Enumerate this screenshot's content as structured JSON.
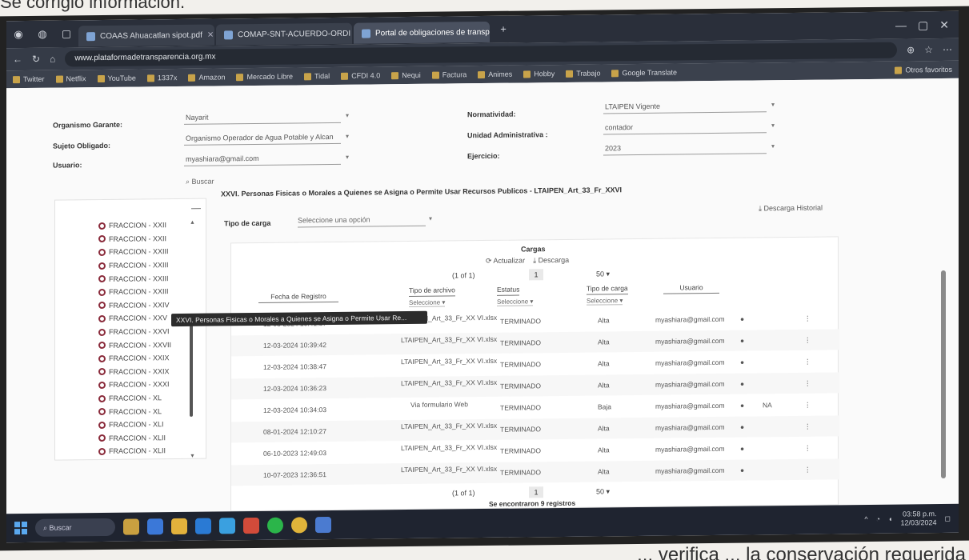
{
  "captions": {
    "top": "Se corrigió información.",
    "bottom": "... verifica ... la conservación requerida"
  },
  "browser": {
    "tabs": [
      {
        "label": "COAAS Ahuacatlan sipot.pdf"
      },
      {
        "label": "COMAP-SNT-ACUERDO-ORDI"
      },
      {
        "label": "Portal de obligaciones de transparencia"
      }
    ],
    "url": "www.plataformadetransparencia.org.mx",
    "bookmarks": [
      "Twitter",
      "Netflix",
      "YouTube",
      "1337x",
      "Amazon",
      "Mercado Libre",
      "Tidal",
      "CFDI 4.0",
      "Nequi",
      "Factura",
      "Animes",
      "Hobby",
      "Trabajo",
      "Google Translate"
    ],
    "bookmarks_right": "Otros favoritos"
  },
  "form": {
    "organismo_label": "Organismo Garante:",
    "organismo_value": "Nayarit",
    "sujeto_label": "Sujeto Obligado:",
    "sujeto_value": "Organismo Operador de Agua Potable y Alcan",
    "usuario_label": "Usuario:",
    "usuario_value": "myashiara@gmail.com",
    "normatividad_label": "Normatividad:",
    "normatividad_value": "LTAIPEN Vigente",
    "unidad_label": "Unidad Administrativa :",
    "unidad_value": "contador",
    "ejercicio_label": "Ejercicio:",
    "ejercicio_value": "2023",
    "buscar": "Buscar"
  },
  "fraccion_title": "XXVI. Personas Fisicas o Morales a Quienes se Asigna o Permite Usar Recursos Publicos - LTAIPEN_Art_33_Fr_XXVI",
  "descarga_historial": "Descarga Historial",
  "fracciones": [
    "FRACCION - XXII",
    "FRACCION - XXII",
    "FRACCION - XXIII",
    "FRACCION - XXIII",
    "FRACCION - XXIII",
    "FRACCION - XXIII",
    "FRACCION - XXIV",
    "FRACCION - XXV",
    "FRACCION - XXVI",
    "FRACCION - XXVII",
    "FRACCION - XXIX",
    "FRACCION - XXIX",
    "FRACCION - XXXI",
    "FRACCION - XL",
    "FRACCION - XL",
    "FRACCION - XLI",
    "FRACCION - XLII",
    "FRACCION - XLII"
  ],
  "tooltip": "XXVI. Personas Fisicas o Morales a Quienes se Asigna o Permite Usar Re...",
  "tipo_carga": {
    "label": "Tipo de carga",
    "placeholder": "Seleccione una opción"
  },
  "cargas": {
    "title": "Cargas",
    "actualizar": "Actualizar",
    "descarga": "Descarga",
    "page_info": "(1 of 1)",
    "page_num": "1",
    "per_page": "50",
    "found": "Se encontraron 9 registros",
    "headers": {
      "fecha": "Fecha de Registro",
      "tipo_archivo": "Tipo de archivo",
      "estatus": "Estatus",
      "tipo_carga": "Tipo de carga",
      "usuario": "Usuario"
    },
    "selecciones": "Seleccione",
    "rows": [
      {
        "fecha": "12-03-2024 10:41:37",
        "archivo": "LTAIPEN_Art_33_Fr_XX VI.xlsx",
        "estatus": "TERMINADO",
        "carga": "Alta",
        "usuario": "myashiara@gmail.com",
        "extra": ""
      },
      {
        "fecha": "12-03-2024 10:39:42",
        "archivo": "LTAIPEN_Art_33_Fr_XX VI.xlsx",
        "estatus": "TERMINADO",
        "carga": "Alta",
        "usuario": "myashiara@gmail.com",
        "extra": ""
      },
      {
        "fecha": "12-03-2024 10:38:47",
        "archivo": "LTAIPEN_Art_33_Fr_XX VI.xlsx",
        "estatus": "TERMINADO",
        "carga": "Alta",
        "usuario": "myashiara@gmail.com",
        "extra": ""
      },
      {
        "fecha": "12-03-2024 10:36:23",
        "archivo": "LTAIPEN_Art_33_Fr_XX VI.xlsx",
        "estatus": "TERMINADO",
        "carga": "Alta",
        "usuario": "myashiara@gmail.com",
        "extra": ""
      },
      {
        "fecha": "12-03-2024 10:34:03",
        "archivo": "Via formulario Web",
        "estatus": "TERMINADO",
        "carga": "Baja",
        "usuario": "myashiara@gmail.com",
        "extra": "NA"
      },
      {
        "fecha": "08-01-2024 12:10:27",
        "archivo": "LTAIPEN_Art_33_Fr_XX VI.xlsx",
        "estatus": "TERMINADO",
        "carga": "Alta",
        "usuario": "myashiara@gmail.com",
        "extra": ""
      },
      {
        "fecha": "06-10-2023 12:49:03",
        "archivo": "LTAIPEN_Art_33_Fr_XX VI.xlsx",
        "estatus": "TERMINADO",
        "carga": "Alta",
        "usuario": "myashiara@gmail.com",
        "extra": ""
      },
      {
        "fecha": "10-07-2023 12:36:51",
        "archivo": "LTAIPEN_Art_33_Fr_XX VI.xlsx",
        "estatus": "TERMINADO",
        "carga": "Alta",
        "usuario": "myashiara@gmail.com",
        "extra": ""
      }
    ]
  },
  "taskbar": {
    "search": "Buscar",
    "time": "03:58 p.m.",
    "date": "12/03/2024"
  }
}
